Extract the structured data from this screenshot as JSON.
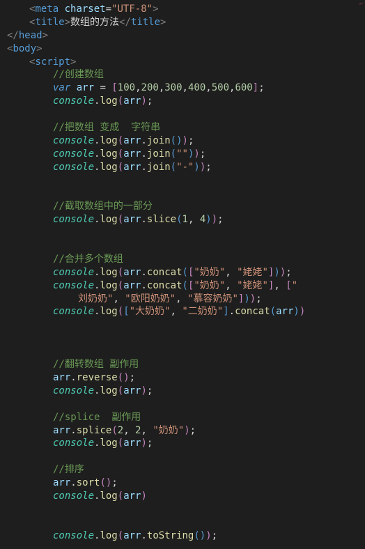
{
  "lines": [
    {
      "ind": 1,
      "html": "<span class='punct'>&lt;</span><span class='tag'>meta</span> <span class='attr'>charset</span><span class='white'>=</span><span class='str'>\"UTF-8\"</span><span class='punct'>&gt;</span>"
    },
    {
      "ind": 1,
      "html": "<span class='punct'>&lt;</span><span class='tag'>title</span><span class='punct'>&gt;</span><span class='white'>数组的方法</span><span class='punct'>&lt;/</span><span class='tag'>title</span><span class='punct'>&gt;</span>"
    },
    {
      "ind": 0,
      "html": "<span class='punct'>&lt;/</span><span class='tag'>head</span><span class='punct'>&gt;</span>"
    },
    {
      "ind": 0,
      "html": "<span class='punct'>&lt;</span><span class='tag'>body</span><span class='punct'>&gt;</span>"
    },
    {
      "ind": 1,
      "html": "<span class='punct'>&lt;</span><span class='tag'>script</span><span class='punct'>&gt;</span>"
    },
    {
      "ind": 2,
      "html": "<span class='comm'>//创建数组</span>"
    },
    {
      "ind": 2,
      "html": "<span class='kw' style='font-style:italic'>var</span> <span class='ident'>arr</span> <span class='white'>=</span> <span class='pink'>[</span><span class='num'>100</span><span class='white'>,</span><span class='num'>200</span><span class='white'>,</span><span class='num'>300</span><span class='white'>,</span><span class='num'>400</span><span class='white'>,</span><span class='num'>500</span><span class='white'>,</span><span class='num'>600</span><span class='pink'>]</span><span class='white'>;</span>"
    },
    {
      "ind": 2,
      "html": "<span class='obj'>console</span><span class='white'>.</span><span class='func'>log</span><span class='pink'>(</span><span class='ident'>arr</span><span class='pink'>)</span><span class='white'>;</span>"
    },
    {
      "blank": true
    },
    {
      "ind": 2,
      "html": "<span class='comm'>//把数组 变成  字符串</span>"
    },
    {
      "ind": 2,
      "html": "<span class='obj'>console</span><span class='white'>.</span><span class='func'>log</span><span class='pink'>(</span><span class='ident'>arr</span><span class='white'>.</span><span class='func'>join</span><span class='kw'>(</span><span class='kw'>)</span><span class='pink'>)</span><span class='white'>;</span>"
    },
    {
      "ind": 2,
      "html": "<span class='obj'>console</span><span class='white'>.</span><span class='func'>log</span><span class='pink'>(</span><span class='ident'>arr</span><span class='white'>.</span><span class='func'>join</span><span class='kw'>(</span><span class='str'>\"\"</span><span class='kw'>)</span><span class='pink'>)</span><span class='white'>;</span>"
    },
    {
      "ind": 2,
      "html": "<span class='obj'>console</span><span class='white'>.</span><span class='func'>log</span><span class='pink'>(</span><span class='ident'>arr</span><span class='white'>.</span><span class='func'>join</span><span class='kw'>(</span><span class='str'>\"-\"</span><span class='kw'>)</span><span class='pink'>)</span><span class='white'>;</span>"
    },
    {
      "blank": true
    },
    {
      "blank": true
    },
    {
      "ind": 2,
      "html": "<span class='comm'>//截取数组中的一部分</span>"
    },
    {
      "ind": 2,
      "html": "<span class='obj'>console</span><span class='white'>.</span><span class='func'>log</span><span class='pink'>(</span><span class='ident'>arr</span><span class='white'>.</span><span class='func'>slice</span><span class='kw'>(</span><span class='num'>1</span><span class='white'>, </span><span class='num'>4</span><span class='kw'>)</span><span class='pink'>)</span><span class='white'>;</span>"
    },
    {
      "blank": true
    },
    {
      "blank": true
    },
    {
      "ind": 2,
      "html": "<span class='comm'>//合并多个数组</span>"
    },
    {
      "ind": 2,
      "html": "<span class='obj'>console</span><span class='white'>.</span><span class='func'>log</span><span class='pink'>(</span><span class='ident'>arr</span><span class='white'>.</span><span class='func'>concat</span><span class='kw'>(</span><span class='pink'>[</span><span class='str'>\"奶奶\"</span><span class='white'>, </span><span class='str'>\"姥姥\"</span><span class='pink'>]</span><span class='kw'>)</span><span class='pink'>)</span><span class='white'>;</span>"
    },
    {
      "ind": 2,
      "html": "<span class='obj'>console</span><span class='white'>.</span><span class='func'>log</span><span class='pink'>(</span><span class='ident'>arr</span><span class='white'>.</span><span class='func'>concat</span><span class='kw'>(</span><span class='pink'>[</span><span class='str'>\"奶奶\"</span><span class='white'>, </span><span class='str'>\"姥姥\"</span><span class='pink'>]</span><span class='white'>, </span><span class='pink'>[</span><span class='str'>\"</span>"
    },
    {
      "ind": 3,
      "html": "<span class='str'>刘奶奶\"</span><span class='white'>, </span><span class='str'>\"欧阳奶奶\"</span><span class='white'>, </span><span class='str'>\"慕容奶奶\"</span><span class='pink'>]</span><span class='kw'>)</span><span class='pink'>)</span><span class='white'>;</span>"
    },
    {
      "ind": 2,
      "html": "<span class='obj'>console</span><span class='white'>.</span><span class='func'>log</span><span class='pink'>(</span><span class='kw'>[</span><span class='str'>\"大奶奶\"</span><span class='white'>, </span><span class='str'>\"二奶奶\"</span><span class='kw'>]</span><span class='white'>.</span><span class='func'>concat</span><span class='kw'>(</span><span class='ident'>arr</span><span class='kw'>)</span><span class='pink'>)</span>"
    },
    {
      "blank": true
    },
    {
      "blank": true
    },
    {
      "blank": true
    },
    {
      "ind": 2,
      "html": "<span class='comm'>//翻转数组 副作用</span>"
    },
    {
      "ind": 2,
      "html": "<span class='ident'>arr</span><span class='white'>.</span><span class='func'>reverse</span><span class='pink'>(</span><span class='pink'>)</span><span class='white'>;</span>"
    },
    {
      "ind": 2,
      "html": "<span class='obj'>console</span><span class='white'>.</span><span class='func'>log</span><span class='pink'>(</span><span class='ident'>arr</span><span class='pink'>)</span><span class='white'>;</span>"
    },
    {
      "blank": true
    },
    {
      "ind": 2,
      "html": "<span class='comm'>//splice  副作用</span>"
    },
    {
      "ind": 2,
      "html": "<span class='ident'>arr</span><span class='white'>.</span><span class='func'>splice</span><span class='pink'>(</span><span class='num'>2</span><span class='white'>, </span><span class='num'>2</span><span class='white'>, </span><span class='str'>\"奶奶\"</span><span class='pink'>)</span><span class='white'>;</span>"
    },
    {
      "ind": 2,
      "html": "<span class='obj'>console</span><span class='white'>.</span><span class='func'>log</span><span class='pink'>(</span><span class='ident'>arr</span><span class='pink'>)</span><span class='white'>;</span>"
    },
    {
      "blank": true
    },
    {
      "ind": 2,
      "html": "<span class='comm'>//排序</span>"
    },
    {
      "ind": 2,
      "html": "<span class='ident'>arr</span><span class='white'>.</span><span class='func'>sort</span><span class='pink'>(</span><span class='pink'>)</span><span class='white'>;</span>"
    },
    {
      "ind": 2,
      "html": "<span class='obj'>console</span><span class='white'>.</span><span class='func'>log</span><span class='pink'>(</span><span class='ident'>arr</span><span class='pink'>)</span>"
    },
    {
      "blank": true
    },
    {
      "blank": true
    },
    {
      "ind": 2,
      "html": "<span class='obj'>console</span><span class='white'>.</span><span class='func'>log</span><span class='pink'>(</span><span class='ident'>arr</span><span class='white'>.</span><span class='func'>toString</span><span class='kw'>(</span><span class='kw'>)</span><span class='pink'>)</span><span class='white'>;</span>"
    }
  ],
  "edge_glyph": "⌐"
}
